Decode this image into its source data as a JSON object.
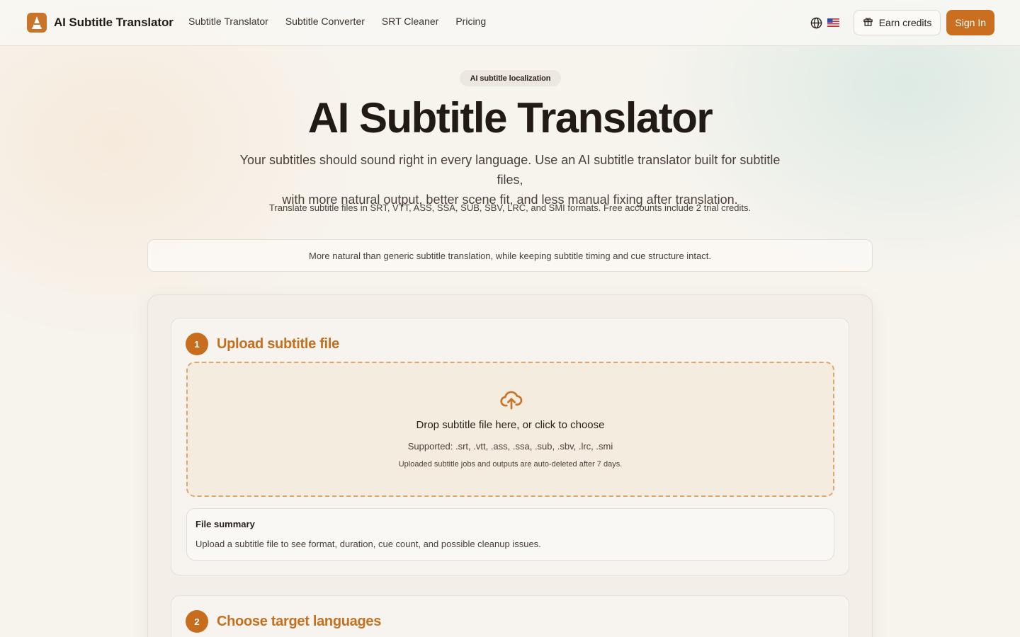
{
  "header": {
    "brand_name": "AI Subtitle Translator",
    "nav": [
      "Subtitle Translator",
      "Subtitle Converter",
      "SRT Cleaner",
      "Pricing"
    ],
    "earn_credits_label": "Earn credits",
    "sign_in_label": "Sign In",
    "language_flag": "us-flag",
    "icons": [
      "globe-icon",
      "gift-icon"
    ]
  },
  "hero": {
    "badge": "AI subtitle localization",
    "title": "AI Subtitle Translator",
    "subtitle_line1": "Your subtitles should sound right in every language. Use an AI subtitle translator built for subtitle files,",
    "subtitle_line2": "with more natural output, better scene fit, and less manual fixing after translation.",
    "formats_note": "Translate subtitle files in SRT, VTT, ASS, SSA, SUB, SBV, LRC, and SMI formats. Free accounts include 2 trial credits."
  },
  "notice": "More natural than generic subtitle translation, while keeping subtitle timing and cue structure intact.",
  "steps": [
    {
      "number": "1",
      "title": "Upload subtitle file",
      "dropzone": {
        "title": "Drop subtitle file here, or click to choose",
        "supported": "Supported: .srt, .vtt, .ass, .ssa, .sub, .sbv, .lrc, .smi",
        "note": "Uploaded subtitle jobs and outputs are auto-deleted after 7 days.",
        "icon": "cloud-upload-icon"
      },
      "summary": {
        "title": "File summary",
        "text": "Upload a subtitle file to see format, duration, cue count, and possible cleanup issues."
      }
    },
    {
      "number": "2",
      "title": "Choose target languages"
    }
  ],
  "colors": {
    "accent": "#c96f1f",
    "step_title": "#c4701f",
    "dropzone_border": "#e0a56a",
    "background": "#f7f4ee"
  }
}
